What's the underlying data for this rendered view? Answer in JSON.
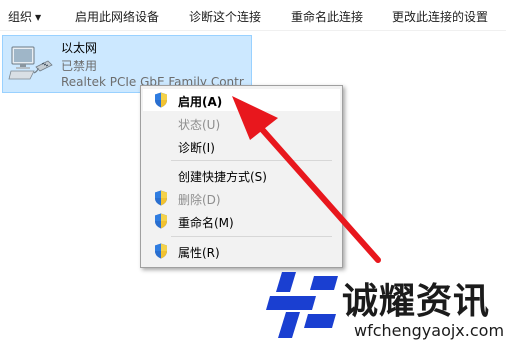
{
  "toolbar": {
    "organize": "组织",
    "enable_device": "启用此网络设备",
    "diagnose": "诊断这个连接",
    "rename": "重命名此连接",
    "change_settings": "更改此连接的设置"
  },
  "adapter": {
    "name": "以太网",
    "status": "已禁用",
    "device": "Realtek PCIe GbE Family Contr"
  },
  "context_menu": {
    "items": [
      {
        "label": "启用(A)",
        "icon": "uac-shield-icon",
        "state": "highlighted-default"
      },
      {
        "label": "状态(U)",
        "icon": "",
        "state": "disabled"
      },
      {
        "label": "诊断(I)",
        "icon": "",
        "state": "enabled"
      },
      {
        "label": "创建快捷方式(S)",
        "icon": "",
        "state": "enabled"
      },
      {
        "label": "删除(D)",
        "icon": "uac-shield-icon",
        "state": "disabled"
      },
      {
        "label": "重命名(M)",
        "icon": "uac-shield-icon",
        "state": "enabled"
      },
      {
        "label": "属性(R)",
        "icon": "uac-shield-icon",
        "state": "enabled"
      }
    ]
  },
  "annotation": {
    "arrow_color": "#e8171d"
  },
  "watermark": {
    "title": "诚耀资讯",
    "url": "wfchengyaojx.com",
    "brand_color": "#1a3fd1"
  }
}
